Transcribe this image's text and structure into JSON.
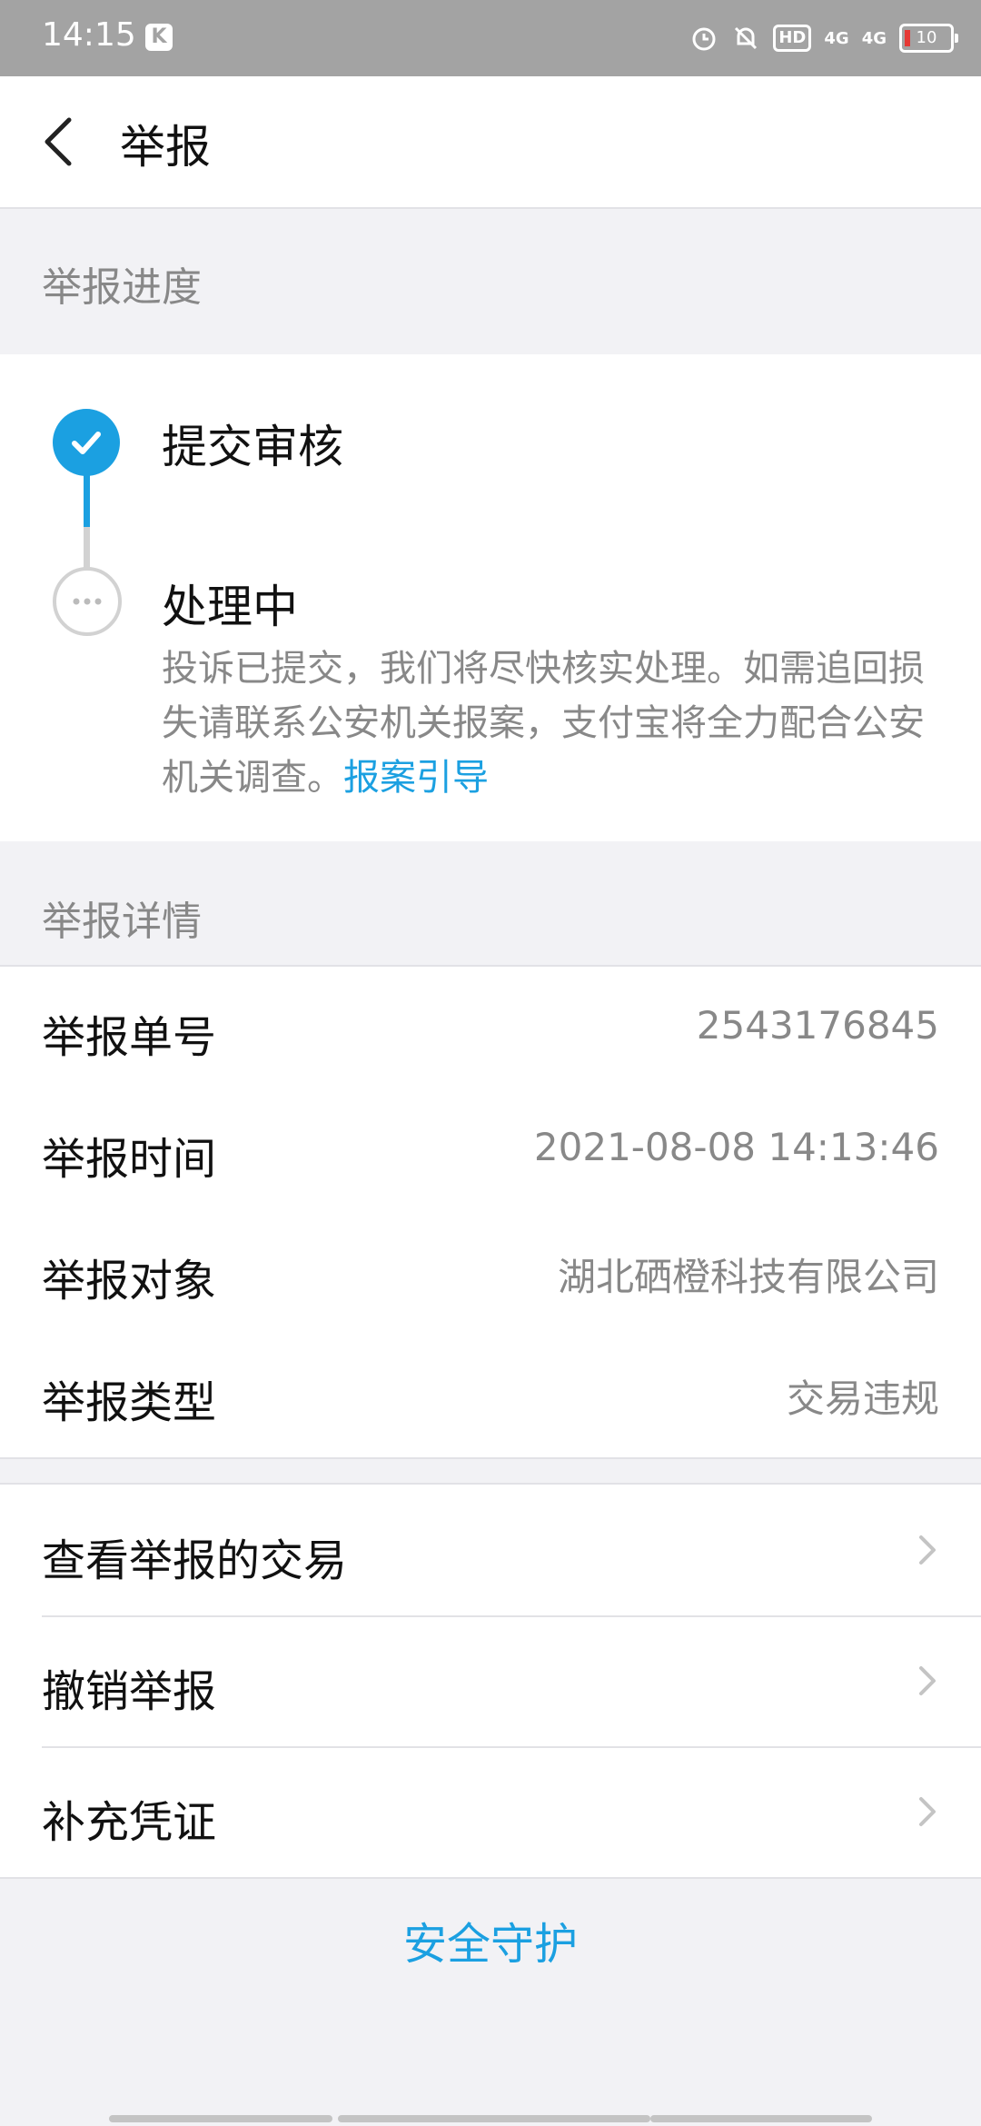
{
  "status_bar": {
    "time": "14:15",
    "hd_label": "HD",
    "sig1": "4G",
    "sig2": "4G",
    "battery": "10"
  },
  "header": {
    "title": "举报"
  },
  "progress_section": {
    "title": "举报进度",
    "steps": [
      {
        "title": "提交审核",
        "status": "done"
      },
      {
        "title": "处理中",
        "status": "pending",
        "description": "投诉已提交，我们将尽快核实处理。如需追回损失请联系公安机关报案，支付宝将全力配合公安机关调查。",
        "link": "报案引导"
      }
    ]
  },
  "detail_section": {
    "title": "举报详情",
    "rows": [
      {
        "label": "举报单号",
        "value": "2543176845"
      },
      {
        "label": "举报时间",
        "value": "2021-08-08 14:13:46"
      },
      {
        "label": "举报对象",
        "value": "湖北硒橙科技有限公司"
      },
      {
        "label": "举报类型",
        "value": "交易违规"
      }
    ]
  },
  "actions": [
    {
      "label": "查看举报的交易"
    },
    {
      "label": "撤销举报"
    },
    {
      "label": "补充凭证"
    }
  ],
  "footer": {
    "link": "安全守护"
  },
  "colors": {
    "accent": "#1ba0e1",
    "background": "#f2f2f5",
    "muted_text": "#888888"
  }
}
